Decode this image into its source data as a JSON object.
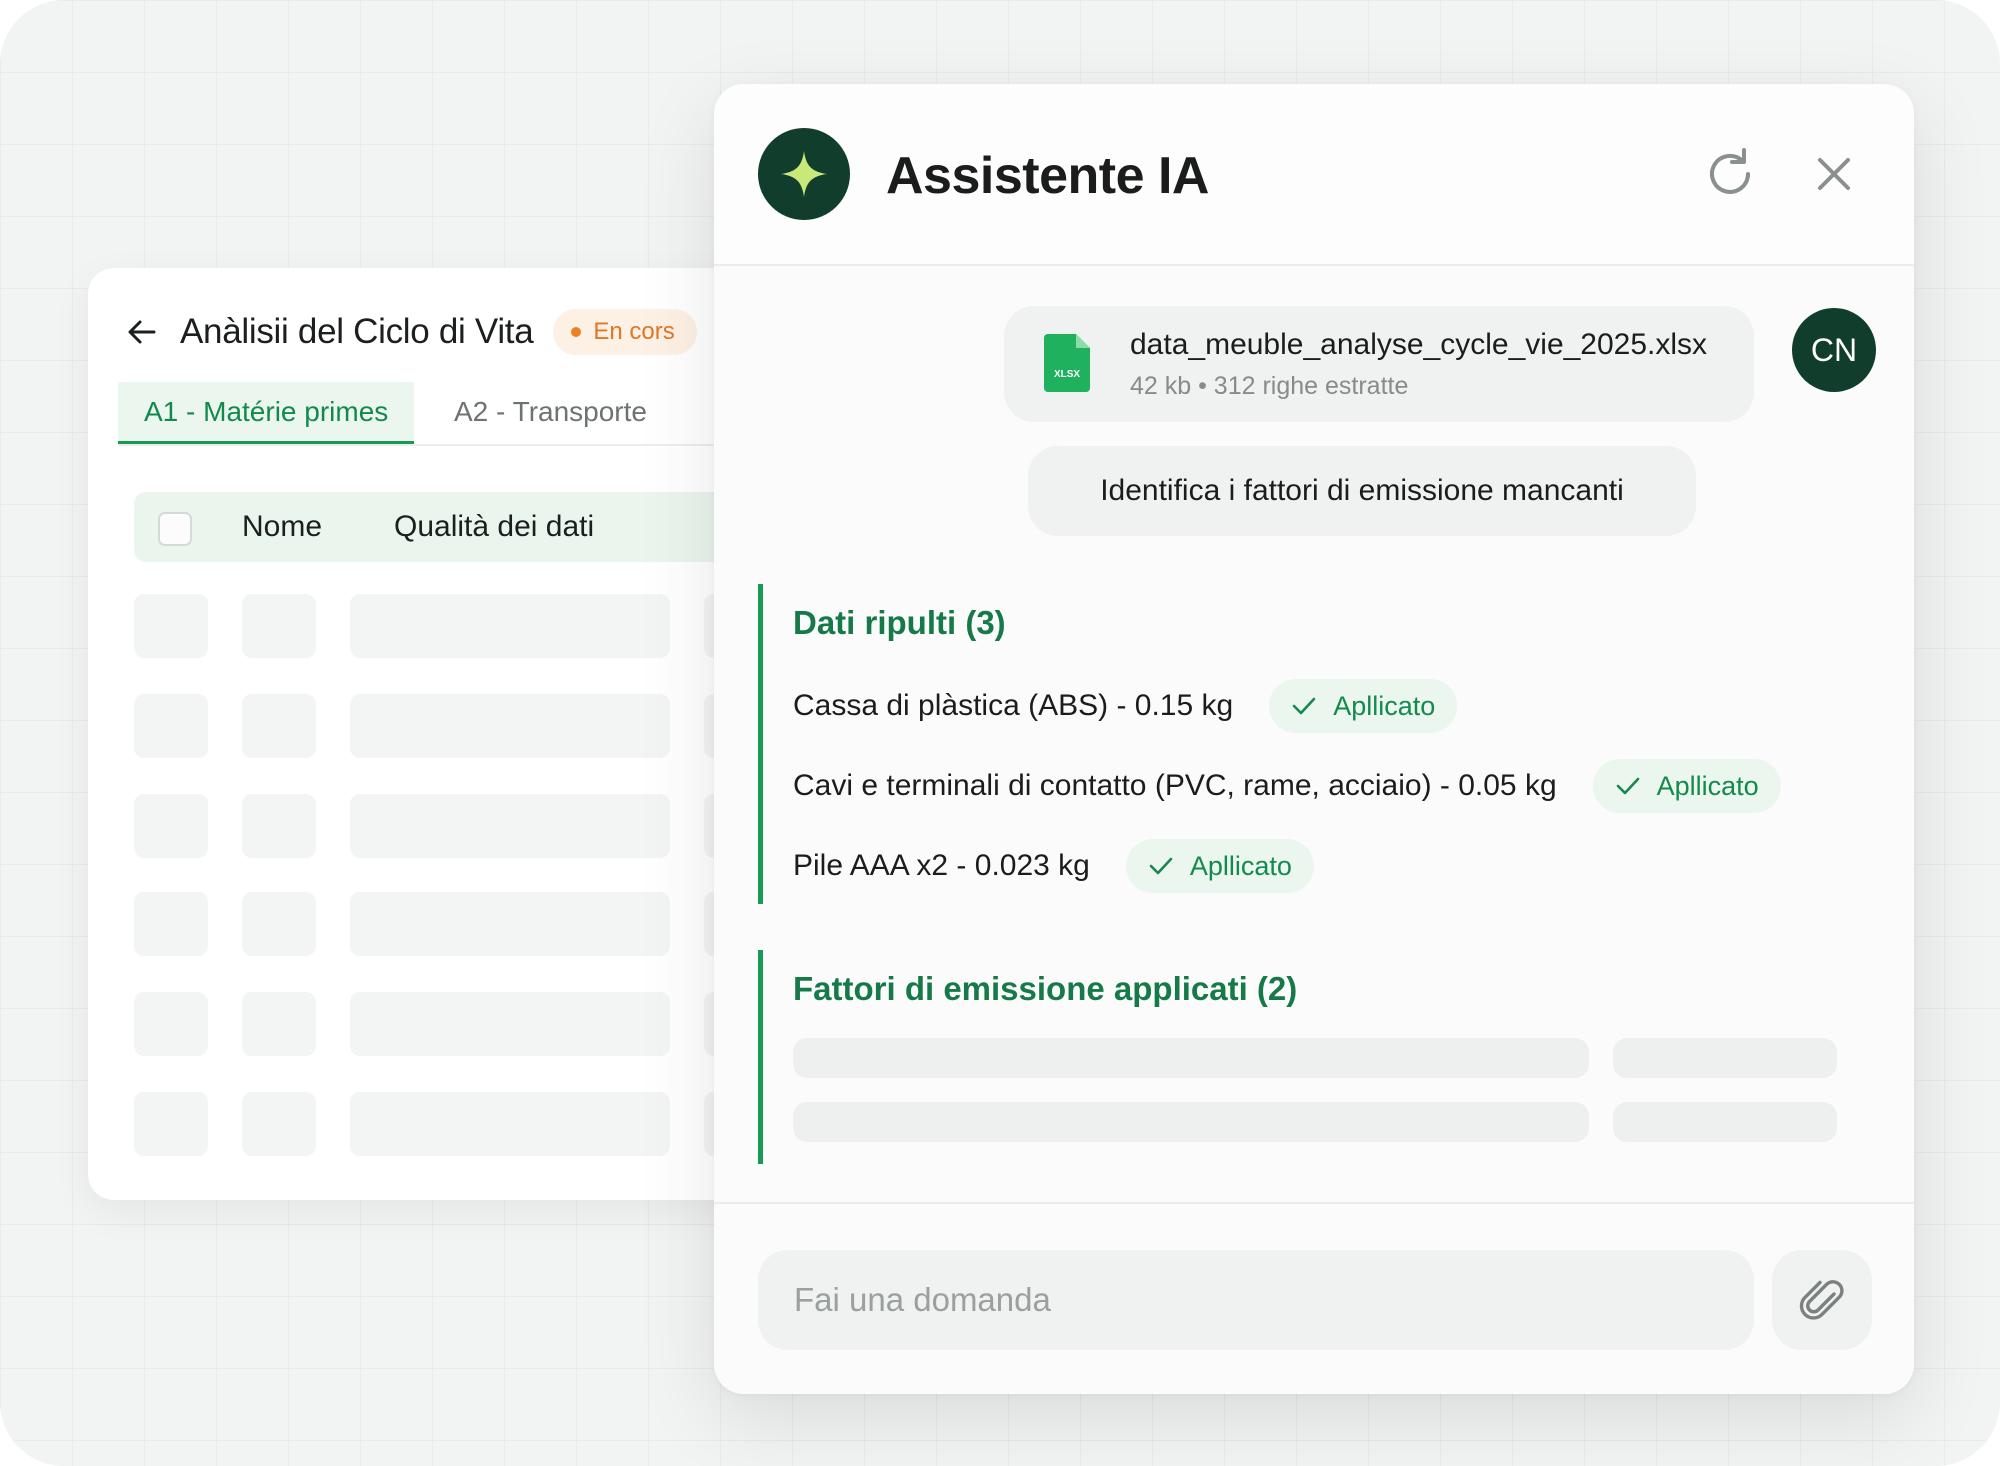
{
  "lca": {
    "title": "Anàlisii del Ciclo di Vita",
    "status": "En cors",
    "tabs": [
      "A1 - Matérie primes",
      "A2 - Transporte"
    ],
    "columns": [
      "Nome",
      "Qualità dei dati"
    ]
  },
  "assistant": {
    "title": "Assistente IA",
    "file": {
      "name": "data_meuble_analyse_cycle_vie_2025.xlsx",
      "meta": "42 kb • 312 righe estratte",
      "type_label": "XLSX"
    },
    "user_initials": "CN",
    "prompt": "Identifica i fattori di emissione mancanti",
    "cleaned": {
      "title": "Dati ripulti (3)",
      "items": [
        {
          "label": "Cassa di plàstica (ABS) - 0.15 kg",
          "status": "Apllicato"
        },
        {
          "label": "Cavi e terminali di contatto (PVC, rame, acciaio) - 0.05 kg",
          "status": "Apllicato"
        },
        {
          "label": "Pile AAA x2 - 0.023 kg",
          "status": "Apllicato"
        }
      ]
    },
    "factors": {
      "title": "Fattori di emissione applicati (2)"
    },
    "input_placeholder": "Fai una domanda"
  },
  "colors": {
    "brand_dark": "#113d2c",
    "accent_green": "#169a54",
    "star": "#c8e87a",
    "status_orange": "#f07f20"
  },
  "icons": [
    "back-arrow-icon",
    "sparkle-icon",
    "refresh-icon",
    "close-icon",
    "xlsx-file-icon",
    "check-icon",
    "paperclip-icon"
  ]
}
